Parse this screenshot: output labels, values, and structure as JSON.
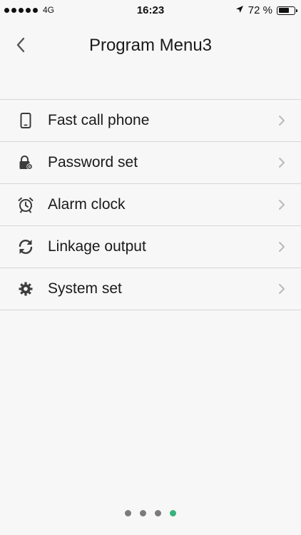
{
  "status_bar": {
    "carrier": "4G",
    "time": "16:23",
    "battery_text": "72 %",
    "battery_level": 0.72
  },
  "nav": {
    "title": "Program Menu3",
    "back_icon": "chevron-left-icon"
  },
  "menu": {
    "items": [
      {
        "label": "Fast call phone",
        "icon": "phone-icon"
      },
      {
        "label": "Password set",
        "icon": "lock-gear-icon"
      },
      {
        "label": "Alarm clock",
        "icon": "alarm-clock-icon"
      },
      {
        "label": "Linkage output",
        "icon": "refresh-icon"
      },
      {
        "label": "System set",
        "icon": "gear-icon"
      }
    ]
  },
  "pagination": {
    "count": 4,
    "active_index": 3,
    "active_color": "#37b37c"
  }
}
